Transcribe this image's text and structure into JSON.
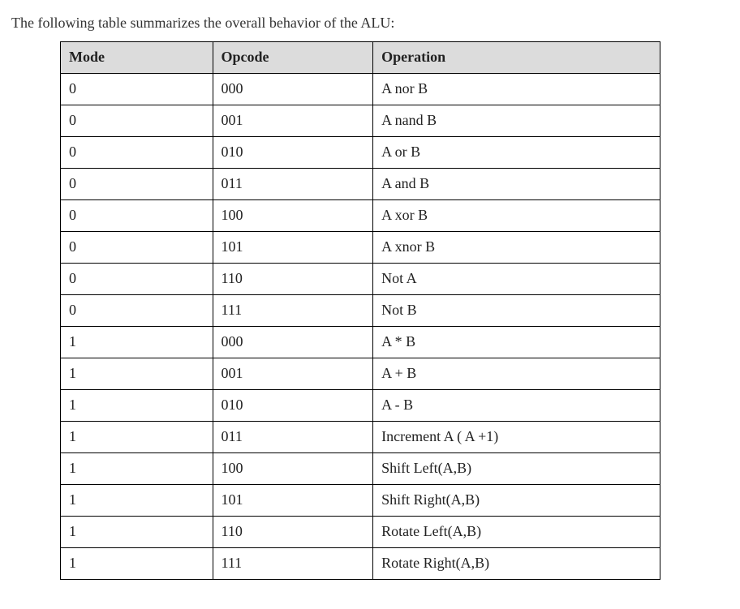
{
  "intro_text": "The following table summarizes the overall behavior of the ALU:",
  "table": {
    "headers": {
      "mode": "Mode",
      "opcode": "Opcode",
      "operation": "Operation"
    },
    "rows": [
      {
        "mode": "0",
        "opcode": "000",
        "operation": "A nor B"
      },
      {
        "mode": "0",
        "opcode": "001",
        "operation": "A nand B"
      },
      {
        "mode": "0",
        "opcode": "010",
        "operation": "A or B"
      },
      {
        "mode": "0",
        "opcode": "011",
        "operation": "A and B"
      },
      {
        "mode": "0",
        "opcode": "100",
        "operation": "A xor B"
      },
      {
        "mode": "0",
        "opcode": "101",
        "operation": "A xnor B"
      },
      {
        "mode": "0",
        "opcode": "110",
        "operation": "Not A"
      },
      {
        "mode": "0",
        "opcode": "111",
        "operation": "Not B"
      },
      {
        "mode": "1",
        "opcode": "000",
        "operation": "A * B"
      },
      {
        "mode": "1",
        "opcode": "001",
        "operation": "A + B"
      },
      {
        "mode": "1",
        "opcode": "010",
        "operation": "A - B"
      },
      {
        "mode": "1",
        "opcode": "011",
        "operation": "Increment A ( A +1)"
      },
      {
        "mode": "1",
        "opcode": "100",
        "operation": "Shift Left(A,B)"
      },
      {
        "mode": "1",
        "opcode": "101",
        "operation": "Shift Right(A,B)"
      },
      {
        "mode": "1",
        "opcode": "110",
        "operation": "Rotate Left(A,B)"
      },
      {
        "mode": "1",
        "opcode": "111",
        "operation": "Rotate Right(A,B)"
      }
    ]
  }
}
